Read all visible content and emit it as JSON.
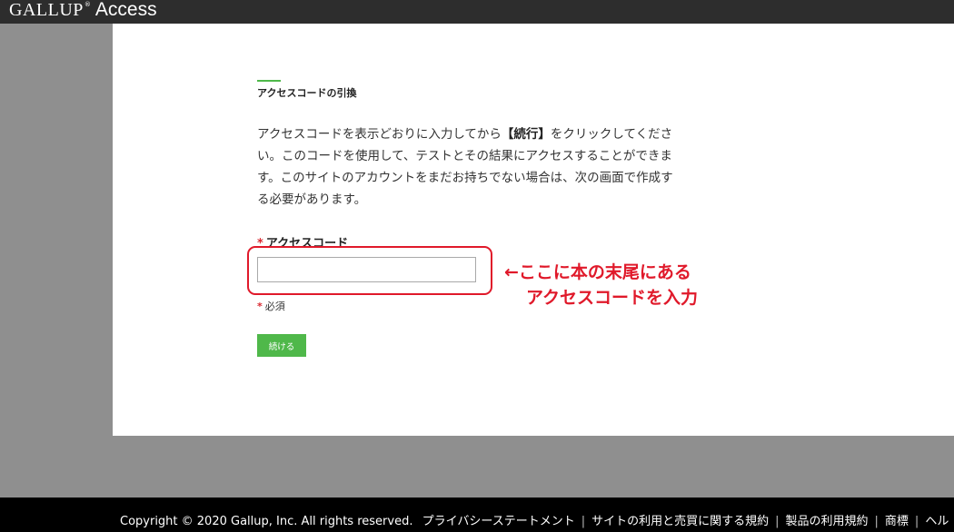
{
  "header": {
    "logo": "GALLUP",
    "logo_reg": "®",
    "product": "Access"
  },
  "main": {
    "section_title": "アクセスコードの引換",
    "instructions": {
      "part1": "アクセスコードを表示どおりに入力してから",
      "continue_ref": "【続行】",
      "part2": "をクリックしてください。このコードを使用して、テストとその結果にアクセスすることができます。このサイトのアカウントをまだお持ちでない場合は、次の画面で作成する必要があります。"
    },
    "field": {
      "required_mark": "*",
      "label": "アクセスコード",
      "value": ""
    },
    "required_note": {
      "mark": "*",
      "text": "必須"
    },
    "continue_label": "続ける"
  },
  "annotation": {
    "line1": "←ここに本の末尾にある",
    "line2": "アクセスコードを入力"
  },
  "footer": {
    "copyright": "Copyright © 2020 Gallup, Inc. All rights reserved.",
    "links": [
      "プライバシーステートメント",
      "サイトの利用と売買に関する規約",
      "製品の利用規約",
      "商標",
      "ヘル"
    ]
  },
  "colors": {
    "accent": "#4fb84a",
    "annotation_red": "#e0192a",
    "required_red": "#d9282f"
  }
}
